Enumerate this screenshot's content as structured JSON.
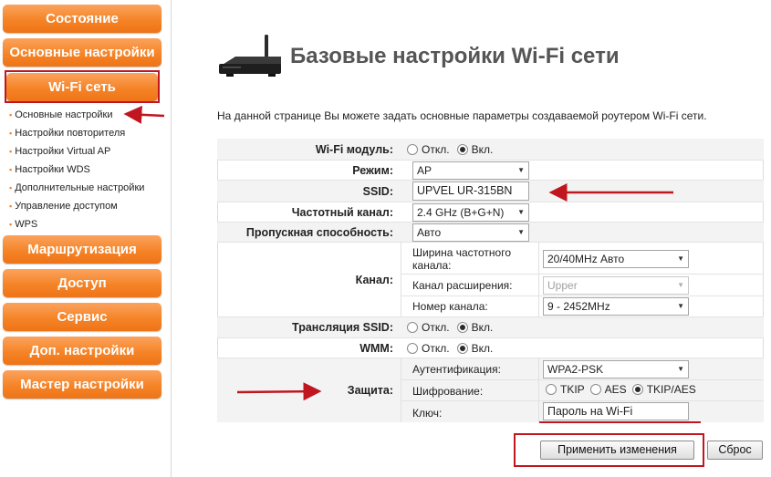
{
  "sidebar": {
    "buttons": [
      {
        "label": "Состояние"
      },
      {
        "label": "Основные настройки"
      },
      {
        "label": "Wi-Fi сеть"
      },
      {
        "label": "Маршрутизация"
      },
      {
        "label": "Доступ"
      },
      {
        "label": "Сервис"
      },
      {
        "label": "Доп. настройки"
      },
      {
        "label": "Мастер настройки"
      }
    ],
    "wifi_items": [
      {
        "label": "Основные настройки"
      },
      {
        "label": "Настройки повторителя"
      },
      {
        "label": "Настройки Virtual AP"
      },
      {
        "label": "Настройки WDS"
      },
      {
        "label": "Дополнительные настройки"
      },
      {
        "label": "Управление доступом"
      },
      {
        "label": "WPS"
      }
    ]
  },
  "header": {
    "title": "Базовые настройки Wi-Fi сети",
    "description": "На данной странице Вы можете задать основные параметры создаваемой роутером Wi-Fi сети."
  },
  "form": {
    "wifi_module": {
      "label": "Wi-Fi модуль:",
      "off": "Откл.",
      "on": "Вкл.",
      "selected": "on"
    },
    "mode": {
      "label": "Режим:",
      "value": "AP"
    },
    "ssid": {
      "label": "SSID:",
      "value": "UPVEL UR-315BN"
    },
    "band": {
      "label": "Частотный канал:",
      "value": "2.4 GHz (B+G+N)"
    },
    "bandwidth": {
      "label": "Пропускная способность:",
      "value": "Авто"
    },
    "channel": {
      "label": "Канал:",
      "width_label_1": "Ширина частотного",
      "width_label_2": "канала:",
      "width_value": "20/40MHz Авто",
      "ext_label": "Канал расширения:",
      "ext_value": "Upper",
      "number_label": "Номер канала:",
      "number_value": "9 - 2452MHz"
    },
    "ssid_broadcast": {
      "label": "Трансляция SSID:",
      "off": "Откл.",
      "on": "Вкл.",
      "selected": "on"
    },
    "wmm": {
      "label": "WMM:",
      "off": "Откл.",
      "on": "Вкл.",
      "selected": "on"
    },
    "security": {
      "label": "Защита:",
      "auth_label": "Аутентификация:",
      "auth_value": "WPA2-PSK",
      "enc_label": "Шифрование:",
      "enc_tkip": "TKIP",
      "enc_aes": "AES",
      "enc_both": "TKIP/AES",
      "enc_selected": "TKIP/AES",
      "key_label": "Ключ:",
      "key_value": "Пароль на Wi-Fi"
    }
  },
  "actions": {
    "apply_label": "Применить изменения",
    "reset_label": "Сброс"
  },
  "colors": {
    "nav_orange": "#f58427",
    "annotation_red": "#c0161f",
    "title_gray": "#555555"
  },
  "icons": {
    "router": "router-icon",
    "bullet": "square-bullet",
    "dropdown": "triangle-down",
    "annotation": "red-arrow"
  }
}
